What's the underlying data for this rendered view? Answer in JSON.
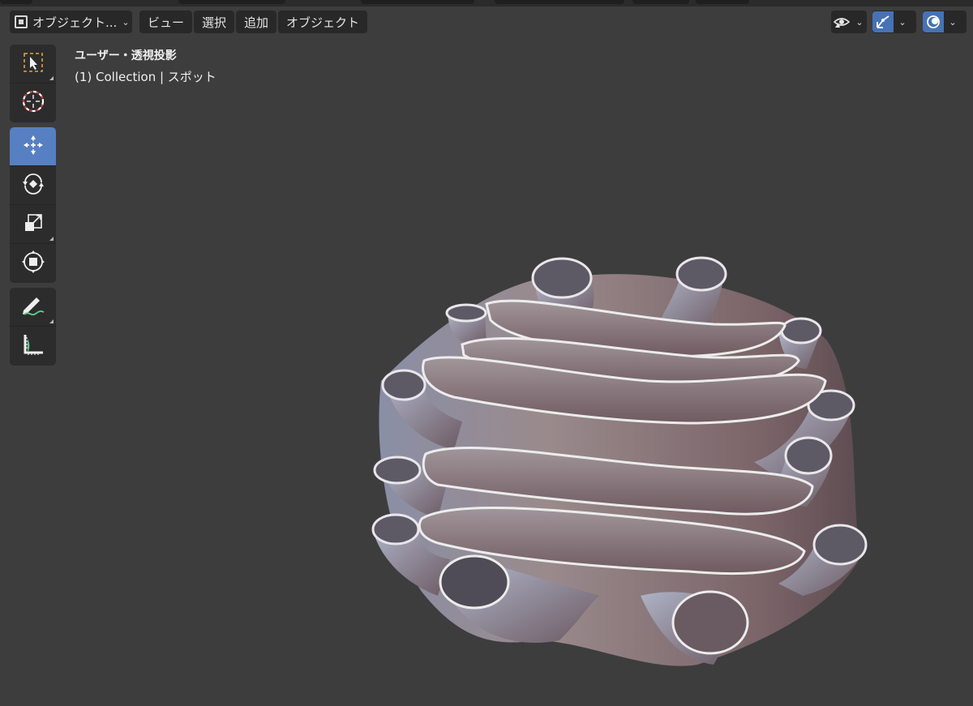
{
  "header": {
    "mode_label": "オブジェクト...",
    "menu": [
      {
        "id": "view",
        "label": "ビュー"
      },
      {
        "id": "select",
        "label": "選択"
      },
      {
        "id": "add",
        "label": "追加"
      },
      {
        "id": "object",
        "label": "オブジェクト"
      }
    ],
    "right_buttons": [
      {
        "name": "visibility-eye-icon",
        "active": false
      },
      {
        "name": "gizmo-toggle-icon",
        "active": true
      },
      {
        "name": "overlays-toggle-icon",
        "active": true
      }
    ]
  },
  "viewport": {
    "view_label": "ユーザー・透視投影",
    "collection_label": "(1) Collection | スポット"
  },
  "toolbar": {
    "groups": [
      [
        "select-box-icon",
        "cursor-icon"
      ],
      [
        "move-icon",
        "rotate-icon",
        "scale-icon",
        "transform-icon"
      ],
      [
        "annotate-icon",
        "measure-icon"
      ]
    ],
    "active_tool": "move-icon"
  },
  "colors": {
    "viewport_bg": "#3d3d3d",
    "header_btn": "#282828",
    "accent": "#4772b3",
    "active_tool": "#5680c2",
    "toolbar_bg": "#2c2c2c"
  }
}
